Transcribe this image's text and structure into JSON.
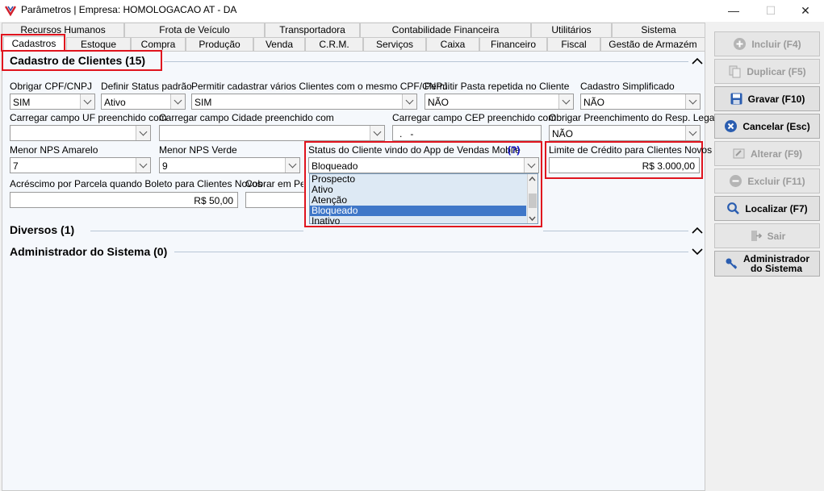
{
  "window": {
    "title": "Parâmetros | Empresa: HOMOLOGACAO AT - DA",
    "minimize": "—",
    "maximize": "☐",
    "close": "✕"
  },
  "tabs_row1": [
    "Recursos Humanos",
    "Frota de Veículo",
    "Transportadora",
    "Contabilidade Financeira",
    "Utilitários",
    "Sistema"
  ],
  "tabs_row2": [
    "Cadastros",
    "Estoque",
    "Compra",
    "Produção",
    "Venda",
    "C.R.M.",
    "Serviços",
    "Caixa",
    "Financeiro",
    "Fiscal",
    "Gestão de Armazém"
  ],
  "sections": {
    "clientes": "Cadastro de Clientes (15)",
    "diversos": "Diversos (1)",
    "admin": "Administrador do Sistema (0)"
  },
  "fields": {
    "cpf_cnpj": {
      "label": "Obrigar CPF/CNPJ",
      "value": "SIM"
    },
    "status_padrao": {
      "label": "Definir Status padrão",
      "value": "Ativo"
    },
    "varios_clientes": {
      "label": "Permitir cadastrar vários Clientes com o mesmo CPF/CNPJ",
      "value": "SIM"
    },
    "pasta_repetida": {
      "label": "Permitir Pasta repetida no Cliente",
      "value": "NÃO"
    },
    "simplificado": {
      "label": "Cadastro Simplificado",
      "value": "NÃO"
    },
    "uf": {
      "label": "Carregar campo UF preenchido com",
      "value": ""
    },
    "cidade": {
      "label": "Carregar campo Cidade preenchido com",
      "value": ""
    },
    "cep": {
      "label": "Carregar campo CEP preenchido com",
      "value": ".   -"
    },
    "resp_legal": {
      "label": "Obrigar Preenchimento do Resp. Legal?",
      "value": "NÃO"
    },
    "nps_amarelo": {
      "label": "Menor NPS Amarelo",
      "value": "7"
    },
    "nps_verde": {
      "label": "Menor NPS Verde",
      "value": "9"
    },
    "status_app": {
      "label": "Status do Cliente vindo do App de Vendas Mobile",
      "help": "(?)",
      "value": "Bloqueado"
    },
    "limite": {
      "label": "Limite de Crédito para Clientes Novos",
      "value": "R$ 3.000,00"
    },
    "acrescimo": {
      "label": "Acréscimo por Parcela quando Boleto para Clientes Novos",
      "value": "R$ 50,00"
    },
    "cobrar": {
      "label": "Cobrar em Pedid",
      "value": ""
    }
  },
  "status_options": [
    "Prospecto",
    "Ativo",
    "Atenção",
    "Bloqueado",
    "Inativo"
  ],
  "status_selected_index": 3,
  "buttons": {
    "incluir": "Incluir (F4)",
    "duplicar": "Duplicar (F5)",
    "gravar": "Gravar (F10)",
    "cancelar": "Cancelar (Esc)",
    "alterar": "Alterar (F9)",
    "excluir": "Excluir (F11)",
    "localizar": "Localizar (F7)",
    "sair": "Sair",
    "admin_line1": "Administrador",
    "admin_line2": "do Sistema"
  },
  "colors": {
    "highlight_red": "#e0141e",
    "selection_blue": "#3f77c8",
    "help_blue": "#1010c8"
  }
}
